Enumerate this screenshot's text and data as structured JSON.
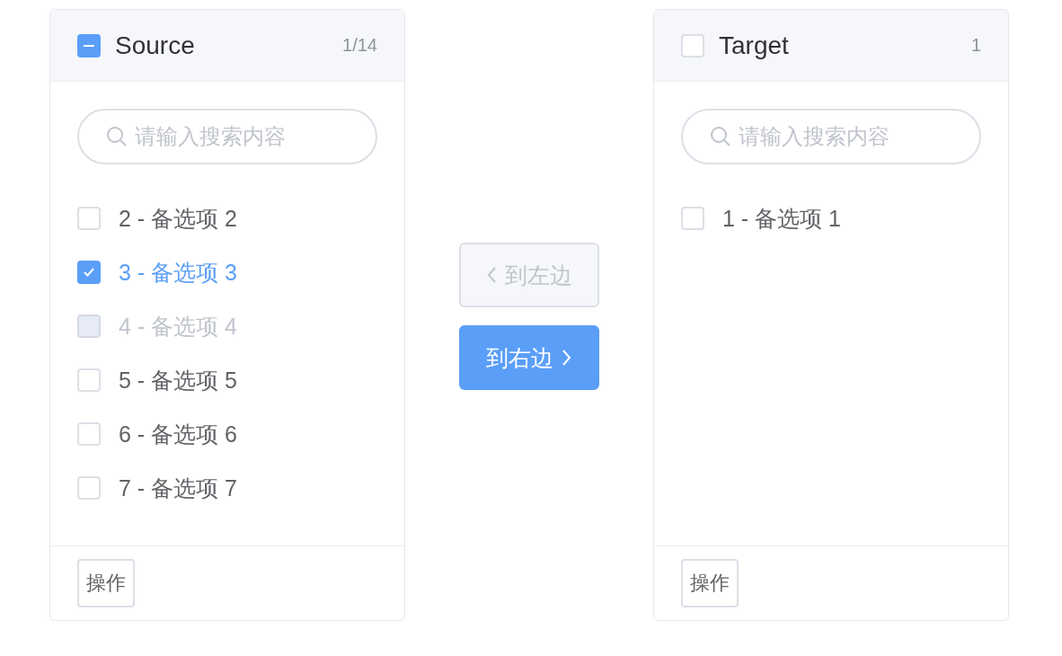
{
  "panels": [
    {
      "title": "Source",
      "checked": false,
      "indeterminate": true,
      "count": "1/14",
      "search": {
        "placeholder": "请输入搜索内容"
      },
      "items": [
        {
          "label": "2 - 备选项 2",
          "checked": false,
          "disabled": false
        },
        {
          "label": "3 - 备选项 3",
          "checked": true,
          "disabled": false
        },
        {
          "label": "4 - 备选项 4",
          "checked": false,
          "disabled": true
        },
        {
          "label": "5 - 备选项 5",
          "checked": false,
          "disabled": false
        },
        {
          "label": "6 - 备选项 6",
          "checked": false,
          "disabled": false
        },
        {
          "label": "7 - 备选项 7",
          "checked": false,
          "disabled": false
        }
      ],
      "footer_button": "操作"
    },
    {
      "title": "Target",
      "checked": false,
      "indeterminate": false,
      "count": "1",
      "search": {
        "placeholder": "请输入搜索内容"
      },
      "items": [
        {
          "label": "1 - 备选项 1",
          "checked": false,
          "disabled": false
        }
      ],
      "footer_button": "操作"
    }
  ],
  "buttons": [
    {
      "label": "到左边",
      "kind": "left",
      "disabled": true
    },
    {
      "label": "到右边",
      "kind": "right",
      "disabled": false
    }
  ]
}
